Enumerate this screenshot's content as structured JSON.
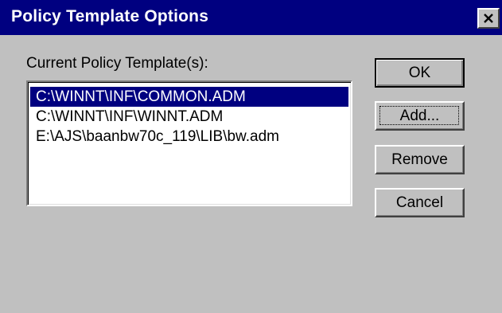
{
  "window": {
    "title": "Policy Template Options",
    "close_glyph": "×"
  },
  "list": {
    "label": "Current Policy Template(s):",
    "items": [
      {
        "label": "C:\\WINNT\\INF\\COMMON.ADM",
        "selected": true
      },
      {
        "label": "C:\\WINNT\\INF\\WINNT.ADM",
        "selected": false
      },
      {
        "label": "E:\\AJS\\baanbw70c_119\\LIB\\bw.adm",
        "selected": false
      }
    ]
  },
  "buttons": {
    "ok": "OK",
    "add": "Add...",
    "remove": "Remove",
    "cancel": "Cancel"
  },
  "colors": {
    "titlebar": "#000080",
    "face": "#c0c0c0",
    "selection": "#000080"
  }
}
